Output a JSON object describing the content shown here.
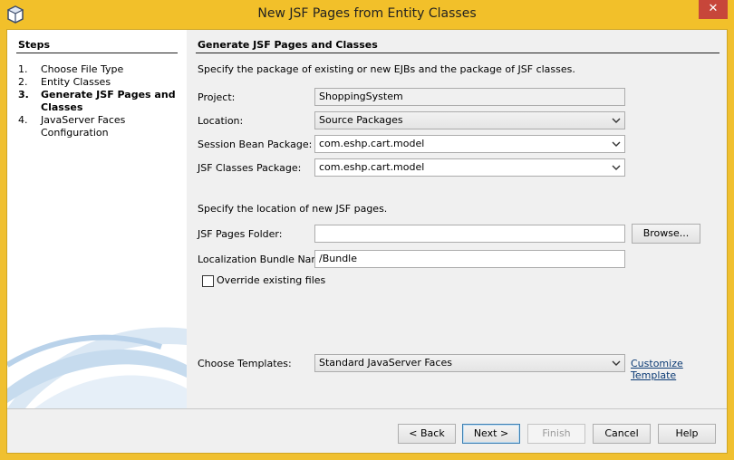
{
  "window": {
    "title": "New JSF Pages from Entity Classes",
    "close_glyph": "✕",
    "titlebar_color": "#f2c02a",
    "close_color": "#c7463a"
  },
  "steps": {
    "heading": "Steps",
    "items": [
      {
        "num": "1.",
        "label": "Choose File Type",
        "current": false
      },
      {
        "num": "2.",
        "label": "Entity Classes",
        "current": false
      },
      {
        "num": "3.",
        "label": "Generate JSF Pages and Classes",
        "current": true
      },
      {
        "num": "4.",
        "label": "JavaServer Faces Configuration",
        "current": false
      }
    ]
  },
  "main": {
    "heading": "Generate JSF Pages and Classes",
    "package_description": "Specify the package of existing or new EJBs and the package of JSF classes.",
    "project": {
      "label": "Project:",
      "value": "ShoppingSystem"
    },
    "location": {
      "label": "Location:",
      "value": "Source Packages"
    },
    "session_bean_package": {
      "label": "Session Bean Package:",
      "value": "com.eshp.cart.model"
    },
    "jsf_classes_package": {
      "label": "JSF Classes Package:",
      "value": "com.eshp.cart.model"
    },
    "pages_description": "Specify the location of new JSF pages.",
    "jsf_pages_folder": {
      "label": "JSF Pages Folder:",
      "value": ""
    },
    "browse_label": "Browse...",
    "localization_bundle": {
      "label": "Localization Bundle Name:",
      "value": "/Bundle"
    },
    "override_label": "Override existing files",
    "override_checked": false,
    "templates": {
      "label": "Choose Templates:",
      "value": "Standard JavaServer Faces"
    },
    "customize_template_label": "Customize Template"
  },
  "footer": {
    "back_label": "< Back",
    "next_label": "Next >",
    "finish_label": "Finish",
    "cancel_label": "Cancel",
    "help_label": "Help"
  }
}
